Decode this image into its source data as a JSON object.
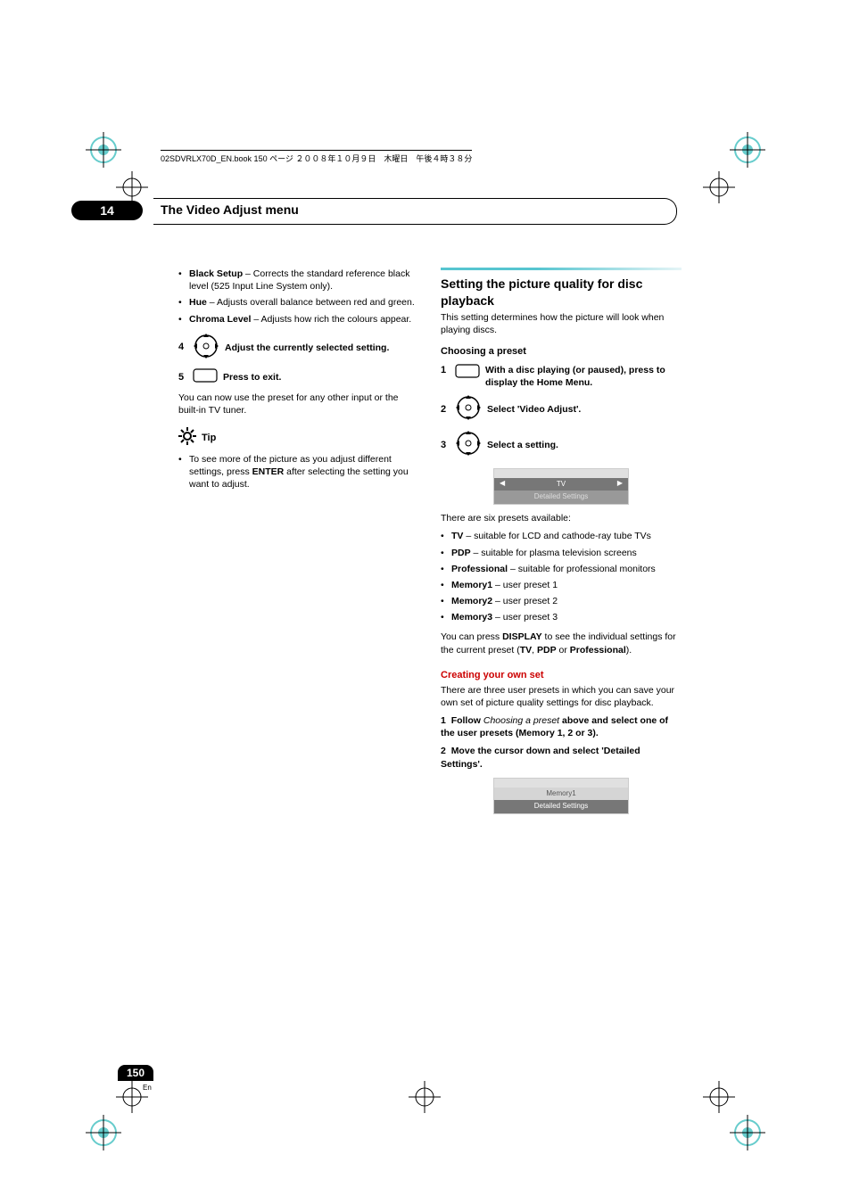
{
  "header": {
    "book_info": "02SDVRLX70D_EN.book  150 ページ  ２００８年１０月９日　木曜日　午後４時３８分"
  },
  "chapter": {
    "num": "14",
    "title": "The Video Adjust menu"
  },
  "left": {
    "bullets_top": [
      {
        "term": "Black Setup",
        "desc": " – Corrects the standard reference black level (525 Input Line System only)."
      },
      {
        "term": "Hue",
        "desc": " – Adjusts overall balance between red and green."
      },
      {
        "term": "Chroma Level",
        "desc": " – Adjusts how rich the colours appear."
      }
    ],
    "step4": {
      "num": "4",
      "text": "Adjust the currently selected setting."
    },
    "step5": {
      "num": "5",
      "text": "Press to exit."
    },
    "after5": "You can now use the preset for any other input or the built-in TV tuner.",
    "tip_label": "Tip",
    "tip_bullet_pre": "To see more of the picture as you adjust different settings, press ",
    "tip_bullet_bold": "ENTER",
    "tip_bullet_post": " after selecting the setting you want to adjust."
  },
  "right": {
    "section_title": "Setting the picture quality for disc playback",
    "section_intro": "This setting determines how the picture will look when playing discs.",
    "sub1": "Choosing a preset",
    "step1": {
      "num": "1",
      "text": "With a disc playing (or paused), press to display the Home Menu."
    },
    "step2": {
      "num": "2",
      "text": "Select 'Video Adjust'."
    },
    "step3": {
      "num": "3",
      "text": "Select a setting."
    },
    "ui1": {
      "row1": "TV",
      "row2": "Detailed Settings",
      "arrow_l": "◀",
      "arrow_r": "▶"
    },
    "presets_intro": "There are six presets available:",
    "presets": [
      {
        "term": "TV",
        "desc": " – suitable for LCD and cathode-ray tube TVs"
      },
      {
        "term": "PDP",
        "desc": " – suitable for plasma television screens"
      },
      {
        "term": "Professional",
        "desc": " – suitable for professional monitors"
      },
      {
        "term": "Memory1",
        "desc": " – user preset 1"
      },
      {
        "term": "Memory2",
        "desc": " – user preset 2"
      },
      {
        "term": "Memory3",
        "desc": " – user preset 3"
      }
    ],
    "presets_note_pre": "You can press ",
    "presets_note_b1": "DISPLAY",
    "presets_note_mid1": " to see the individual settings for the current preset (",
    "presets_note_b2": "TV",
    "presets_note_mid2": ", ",
    "presets_note_b3": "PDP",
    "presets_note_mid3": " or ",
    "presets_note_b4": "Professional",
    "presets_note_post": ").",
    "sub2": "Creating your own set",
    "sub2_intro": "There are three user presets in which you can save your own set of picture quality settings for disc playback.",
    "cstep1": {
      "num": "1",
      "pre": "Follow ",
      "em": "Choosing a preset",
      "post": " above and select one of the user presets (Memory 1, 2 or 3)."
    },
    "cstep2": {
      "num": "2",
      "text": "Move the cursor down and select 'Detailed Settings'."
    },
    "ui2": {
      "row1": "Memory1",
      "row2": "Detailed Settings"
    }
  },
  "footer": {
    "page": "150",
    "lang": "En"
  }
}
